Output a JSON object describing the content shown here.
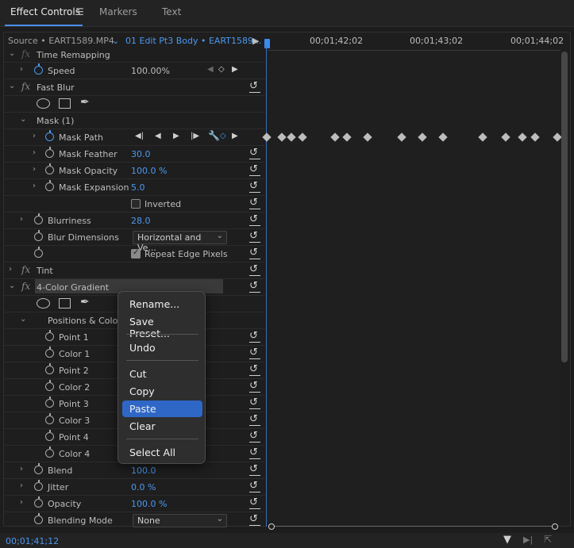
{
  "tabs": [
    {
      "label": "Effect Controls",
      "active": true
    },
    {
      "label": "Markers",
      "active": false
    },
    {
      "label": "Text",
      "active": false
    }
  ],
  "header": {
    "source": "Source • EART1589.MP4",
    "sequence": "01 Edit Pt3 Body • EART1589...",
    "timecodes": [
      "00;01;42;02",
      "00;01;43;02",
      "00;01;44;02"
    ]
  },
  "rows": {
    "time_remapping": "Time Remapping",
    "speed": "Speed",
    "speed_value": "100.00%",
    "fast_blur": "Fast Blur",
    "mask1": "Mask (1)",
    "mask_path": "Mask Path",
    "mask_feather": "Mask Feather",
    "mask_feather_value": "30.0",
    "mask_opacity": "Mask Opacity",
    "mask_opacity_value": "100.0 %",
    "mask_expansion": "Mask Expansion",
    "mask_expansion_value": "5.0",
    "inverted": "Inverted",
    "blurriness": "Blurriness",
    "blurriness_value": "28.0",
    "blur_dimensions": "Blur Dimensions",
    "blur_dimensions_value": "Horizontal and Ve...",
    "repeat_edge": "Repeat Edge Pixels",
    "tint": "Tint",
    "gradient": "4-Color Gradient",
    "positions_colors": "Positions & Colors",
    "point1": "Point 1",
    "color1": "Color 1",
    "point2": "Point 2",
    "color2": "Color 2",
    "point3": "Point 3",
    "color3": "Color 3",
    "point4": "Point 4",
    "color4": "Color 4",
    "blend": "Blend",
    "blend_value": "100.0",
    "jitter": "Jitter",
    "jitter_value": "0.0 %",
    "opacity": "Opacity",
    "opacity_value": "100.0 %",
    "blending_mode": "Blending Mode",
    "blending_mode_value": "None"
  },
  "context_menu": {
    "items": [
      "Rename...",
      "Save Preset...",
      "Undo",
      "Cut",
      "Copy",
      "Paste",
      "Clear",
      "Select All"
    ],
    "highlighted": "Paste"
  },
  "footer": {
    "timecode": "00;01;41;12"
  },
  "colors": {
    "accent": "#4c98f0",
    "highlight": "#2f67c6"
  }
}
